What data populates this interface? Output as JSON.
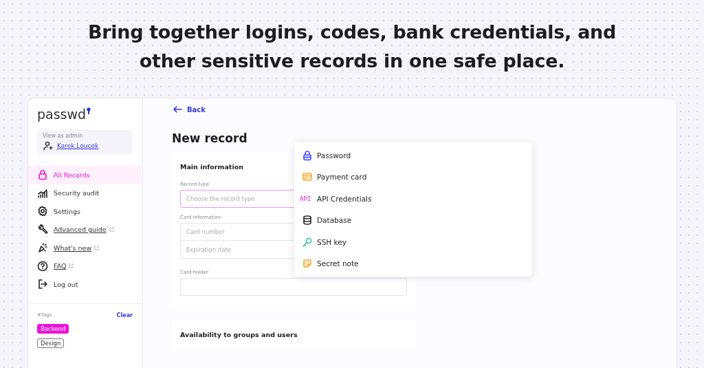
{
  "headline": "Bring together logins, codes, bank credentials, and other sensitive records in one safe place.",
  "sidebar": {
    "logo": "passwd",
    "admin": {
      "caption": "View as admin",
      "user": "Karek.Loucek"
    },
    "items": [
      {
        "kind": "lock",
        "label": "All Records",
        "selected": true,
        "external": false
      },
      {
        "kind": "chart",
        "label": "Security audit",
        "selected": false,
        "external": false
      },
      {
        "kind": "gear",
        "label": "Settings",
        "selected": false,
        "external": false
      },
      {
        "kind": "wrench",
        "label": "Advanced guide",
        "selected": false,
        "external": true
      },
      {
        "kind": "sparkle",
        "label": "What's new",
        "selected": false,
        "external": true
      },
      {
        "kind": "question",
        "label": "FAQ",
        "selected": false,
        "external": true
      },
      {
        "kind": "logout",
        "label": "Log out",
        "selected": false,
        "external": false
      }
    ],
    "tags": {
      "title": "#Tags",
      "clear": "Clear",
      "items": [
        {
          "label": "Backend",
          "selected": true
        },
        {
          "label": "Design",
          "selected": false
        }
      ]
    }
  },
  "main": {
    "back": "Back",
    "title": "New record",
    "card": {
      "title": "Main information",
      "record_type": {
        "label": "Record type",
        "placeholder": "Choose the record type",
        "focused": true
      },
      "card_information": {
        "label": "Card information",
        "fields": [
          {
            "placeholder": "Card number"
          },
          {
            "placeholder": "Expiration date"
          }
        ]
      },
      "card_holder": {
        "label": "Card holder"
      }
    },
    "second_card": {
      "title": "Availability to groups and users"
    }
  },
  "dropdown": [
    {
      "kind": "password",
      "label": "Password"
    },
    {
      "kind": "card",
      "label": "Payment card"
    },
    {
      "kind": "api",
      "icon_text": "API",
      "label": "API Credentials"
    },
    {
      "kind": "database",
      "label": "Database"
    },
    {
      "kind": "key",
      "label": "SSH key"
    },
    {
      "kind": "note",
      "label": "Secret note"
    }
  ]
}
